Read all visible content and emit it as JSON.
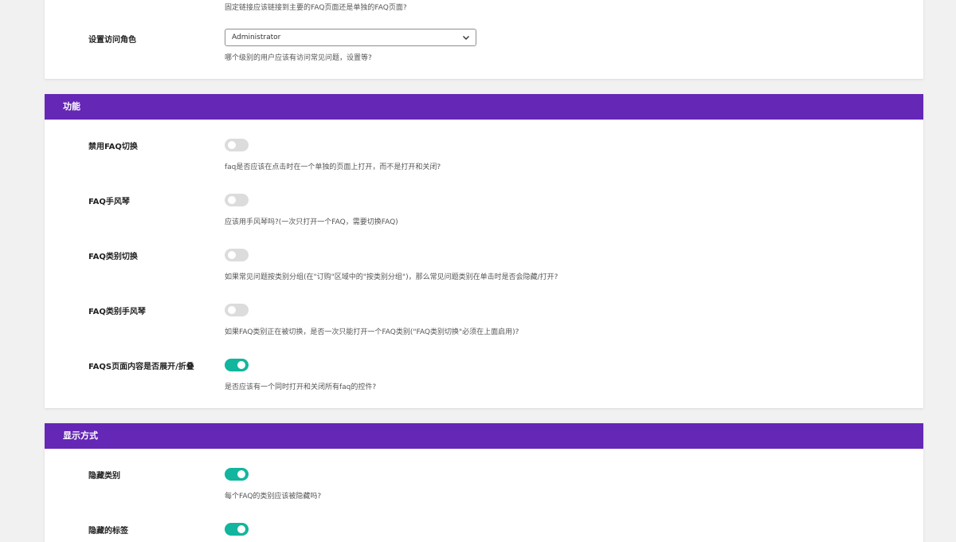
{
  "access_section": {
    "top_desc": "固定链接应该链接到主要的FAQ页面还是单独的FAQ页面?",
    "role_label": "设置访问角色",
    "role_value": "Administrator",
    "role_desc": "哪个级别的用户应该有访问常见问题，设置等?"
  },
  "features_section": {
    "title": "功能",
    "rows": [
      {
        "label": "禁用FAQ切换",
        "desc": "faq是否应该在点击时在一个单独的页面上打开，而不是打开和关闭?",
        "enabled": false
      },
      {
        "label": "FAQ手风琴",
        "desc": "应该用手风琴吗?(一次只打开一个FAQ，需要切换FAQ)",
        "enabled": false
      },
      {
        "label": "FAQ类别切换",
        "desc": "如果常见问题按类别分组(在\"订购\"区域中的\"按类别分组\")，那么常见问题类别在单击时是否会隐藏/打开?",
        "enabled": false
      },
      {
        "label": "FAQ类别手风琴",
        "desc": "如果FAQ类别正在被切换，是否一次只能打开一个FAQ类别(\"FAQ类别切换\"必须在上面启用)?",
        "enabled": false
      },
      {
        "label": "FAQS页面内容是否展开/折叠",
        "desc": "是否应该有一个同时打开和关闭所有faq的控件?",
        "enabled": true
      }
    ]
  },
  "display_section": {
    "title": "显示方式",
    "rows": [
      {
        "label": "隐藏类别",
        "desc": "每个FAQ的类别应该被隐藏吗?",
        "enabled": true
      },
      {
        "label": "隐藏的标签",
        "desc": "",
        "enabled": true
      }
    ]
  },
  "colors": {
    "header_bg": "#6527b5",
    "toggle_on": "#12b59d",
    "toggle_off": "#dcdcdc"
  }
}
